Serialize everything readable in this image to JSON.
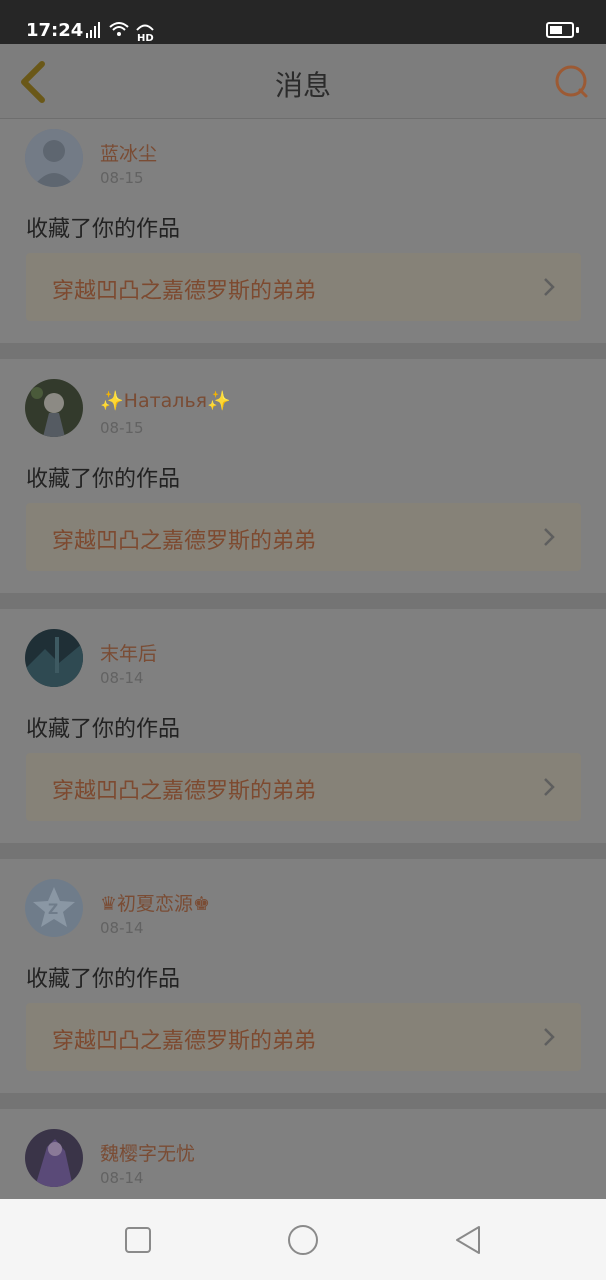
{
  "status": {
    "time": "17:24"
  },
  "header": {
    "title": "消息"
  },
  "icons": {
    "back": "chevron-left-icon",
    "search": "search-icon",
    "chevron": "chevron-right-icon",
    "nav_recent": "square-icon",
    "nav_home": "circle-icon",
    "nav_back": "triangle-left-icon"
  },
  "colors": {
    "accent": "#d87a3c",
    "username": "#7a4c34",
    "overlay_dim": "#808080",
    "nav_bg": "#f5f5f5"
  },
  "notifications": [
    {
      "username": "蓝冰尘",
      "date": "08-15",
      "action": "收藏了你的作品",
      "work_title": "穿越凹凸之嘉德罗斯的弟弟"
    },
    {
      "username": "✨Наталья✨",
      "date": "08-15",
      "action": "收藏了你的作品",
      "work_title": "穿越凹凸之嘉德罗斯的弟弟"
    },
    {
      "username": "末年后",
      "date": "08-14",
      "action": "收藏了你的作品",
      "work_title": "穿越凹凸之嘉德罗斯的弟弟"
    },
    {
      "username": "♛初夏恋源♚",
      "date": "08-14",
      "action": "收藏了你的作品",
      "work_title": "穿越凹凸之嘉德罗斯的弟弟"
    },
    {
      "username": "魏樱字无忧",
      "date": "08-14"
    }
  ]
}
